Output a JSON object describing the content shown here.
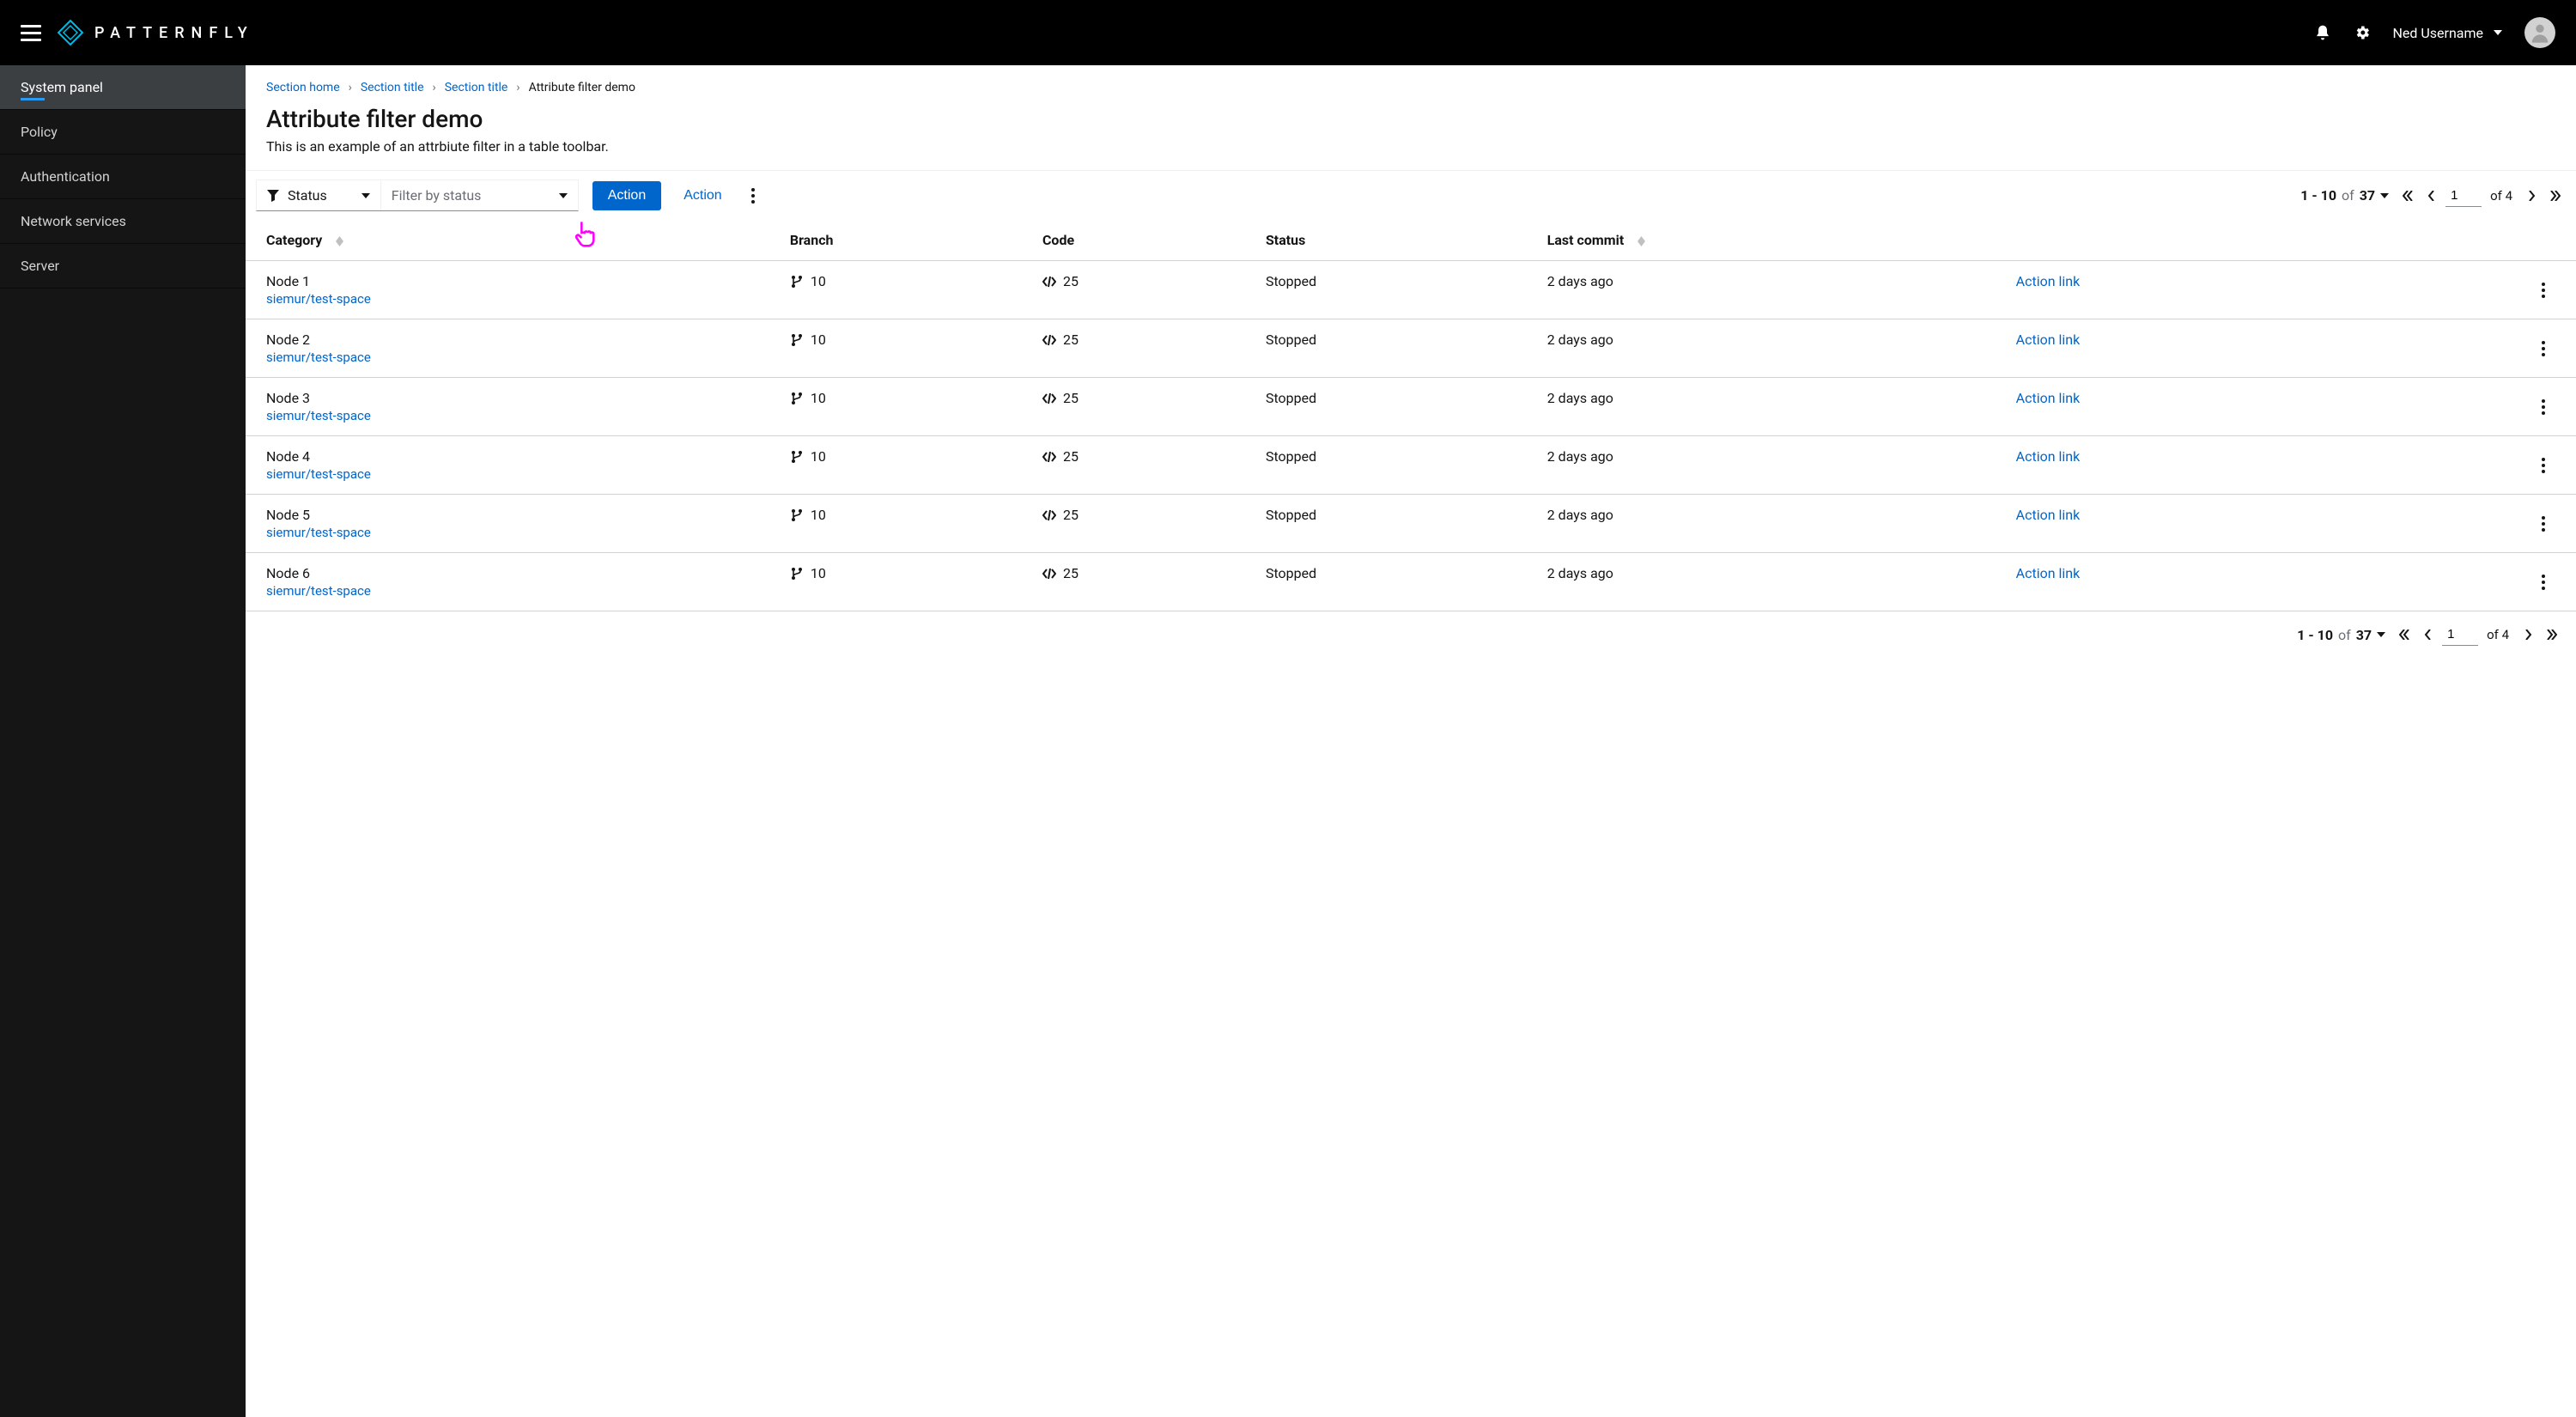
{
  "header": {
    "brand_text": "PATTERNFLY",
    "user_name": "Ned Username"
  },
  "sidebar": {
    "items": [
      {
        "label": "System panel",
        "active": true
      },
      {
        "label": "Policy",
        "active": false
      },
      {
        "label": "Authentication",
        "active": false
      },
      {
        "label": "Network services",
        "active": false
      },
      {
        "label": "Server",
        "active": false
      }
    ]
  },
  "breadcrumb": [
    {
      "label": "Section home",
      "link": true
    },
    {
      "label": "Section title",
      "link": true
    },
    {
      "label": "Section title",
      "link": true
    },
    {
      "label": "Attribute filter demo",
      "link": false
    }
  ],
  "page": {
    "title": "Attribute filter demo",
    "description": "This is an example of an attrbiute filter in a table toolbar."
  },
  "toolbar": {
    "filter_attr_label": "Status",
    "filter_value_placeholder": "Filter by status",
    "primary_action": "Action",
    "secondary_action": "Action"
  },
  "pagination": {
    "range": "1 - 10",
    "of_word": "of",
    "total": "37",
    "page_input": "1",
    "of_pages": "of 4"
  },
  "table": {
    "columns": [
      "Category",
      "Branch",
      "Code",
      "Status",
      "Last commit",
      "",
      ""
    ],
    "action_link_label": "Action link",
    "rows": [
      {
        "name": "Node 1",
        "sub": "siemur/test-space",
        "branch": "10",
        "code": "25",
        "status": "Stopped",
        "last_commit": "2 days ago"
      },
      {
        "name": "Node 2",
        "sub": "siemur/test-space",
        "branch": "10",
        "code": "25",
        "status": "Stopped",
        "last_commit": "2 days ago"
      },
      {
        "name": "Node 3",
        "sub": "siemur/test-space",
        "branch": "10",
        "code": "25",
        "status": "Stopped",
        "last_commit": "2 days ago"
      },
      {
        "name": "Node 4",
        "sub": "siemur/test-space",
        "branch": "10",
        "code": "25",
        "status": "Stopped",
        "last_commit": "2 days ago"
      },
      {
        "name": "Node 5",
        "sub": "siemur/test-space",
        "branch": "10",
        "code": "25",
        "status": "Stopped",
        "last_commit": "2 days ago"
      },
      {
        "name": "Node 6",
        "sub": "siemur/test-space",
        "branch": "10",
        "code": "25",
        "status": "Stopped",
        "last_commit": "2 days ago"
      }
    ]
  }
}
